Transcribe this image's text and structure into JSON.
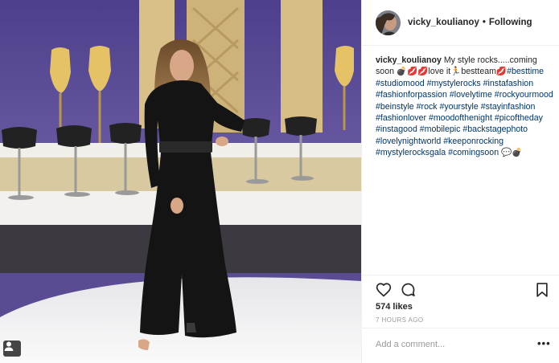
{
  "post": {
    "username": "vicky_koulianoy",
    "follow_status": "Following",
    "separator": "•",
    "caption_text": "My style rocks.....coming soon 💣💋💋love it🏃bestteam💋",
    "hashtags": "#besttime #studiomood #mystylerocks #instafashion #fashionforpassion #lovelytime #rockyourmood #beinstyle #rock #yourstyle #stayinfashion #fashionlover #moodofthenight #picoftheday #instagood #mobilepic #backstagephoto #lovelynightworld #keeponrocking #mystylerocksgala #comingsoon 💬💣",
    "likes": "574 likes",
    "timestamp": "7 HOURS AGO",
    "comment_placeholder": "Add a comment...",
    "more_label": "•••"
  },
  "icons": {
    "like": "heart-icon",
    "comment": "comment-bubble-icon",
    "save": "bookmark-icon",
    "tag": "user-tag-icon"
  },
  "colors": {
    "text": "#262626",
    "hashtag": "#003569",
    "muted": "#999999",
    "divider": "#efefef",
    "studio_wall": "#5b4b92"
  }
}
